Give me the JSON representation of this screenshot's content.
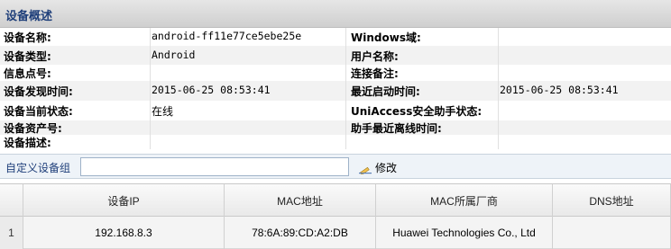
{
  "title": "设备概述",
  "info_rows": [
    {
      "l_label": "设备名称:",
      "l_value": "android-ff11e77ce5ebe25e",
      "r_label": "Windows域:",
      "r_value": ""
    },
    {
      "l_label": "设备类型:",
      "l_value": "Android",
      "r_label": "用户名称:",
      "r_value": ""
    },
    {
      "l_label": "信息点号:",
      "l_value": "",
      "r_label": "连接备注:",
      "r_value": ""
    },
    {
      "l_label": "设备发现时间:",
      "l_value": "2015-06-25 08:53:41",
      "r_label": "最近启动时间:",
      "r_value": "2015-06-25 08:53:41"
    },
    {
      "l_label": "设备当前状态:",
      "l_value": "在线",
      "r_label": "UniAccess安全助手状态:",
      "r_value": ""
    },
    {
      "l_label": "设备资产号:",
      "l_value": "",
      "r_label": "助手最近离线时间:",
      "r_value": ""
    },
    {
      "l_label": "设备描述:",
      "l_value": "",
      "r_label": "",
      "r_value": ""
    }
  ],
  "group_bar": {
    "label": "自定义设备组",
    "input_value": "",
    "edit_label": "修改",
    "edit_icon": "pencil-icon"
  },
  "grid": {
    "columns": [
      "设备IP",
      "MAC地址",
      "MAC所属厂商",
      "DNS地址"
    ],
    "rows": [
      {
        "num": "1",
        "cells": [
          "192.168.8.3",
          "78:6A:89:CD:A2:DB",
          "Huawei Technologies Co., Ltd",
          ""
        ]
      }
    ]
  }
}
